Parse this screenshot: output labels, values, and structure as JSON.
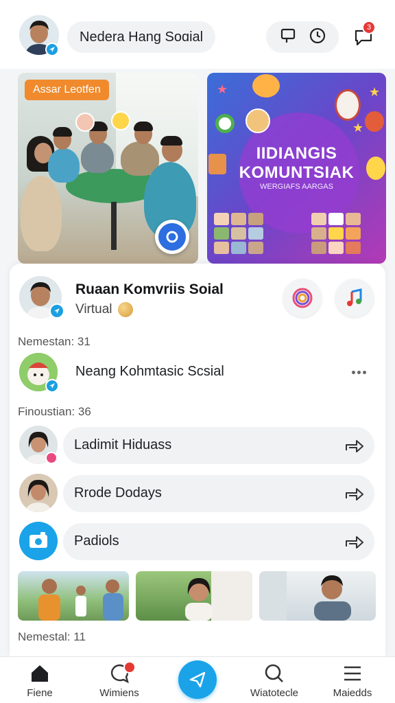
{
  "header": {
    "title": "Nedera Hang Soɑial",
    "icons": [
      "profile-avatar",
      "chat-bubble-icon",
      "clock-icon",
      "message-icon"
    ],
    "message_badge": "3"
  },
  "hero": {
    "left_tag": "Assar Leotfen",
    "right_title_line1": "IIDIANGIS",
    "right_title_line2": "KOMUNTSIAK",
    "right_subtitle": "WERGIAFS AARGAS"
  },
  "group": {
    "title": "Ruaan Komvriis Soial",
    "subtitle": "Virtual"
  },
  "sections": {
    "members_label": "Nemestan: 31",
    "friends_label": "Finoustian: 36",
    "bottom_label": "Nemestal: 11"
  },
  "rows": [
    {
      "label": "Neang Kohmtasic Scsial"
    },
    {
      "label": "Ladimit Hiduass"
    },
    {
      "label": "Rrode Dodays"
    },
    {
      "label": "Padiols"
    }
  ],
  "nav": {
    "items": [
      {
        "label": "Fiene"
      },
      {
        "label": "Wimiens"
      },
      {
        "label": "Wiatotecle"
      },
      {
        "label": "Maiedds"
      }
    ]
  },
  "colors": {
    "accent": "#1aa3e8",
    "badge": "#e53935",
    "tag": "#f08a2c",
    "pill": "#f1f2f4"
  }
}
